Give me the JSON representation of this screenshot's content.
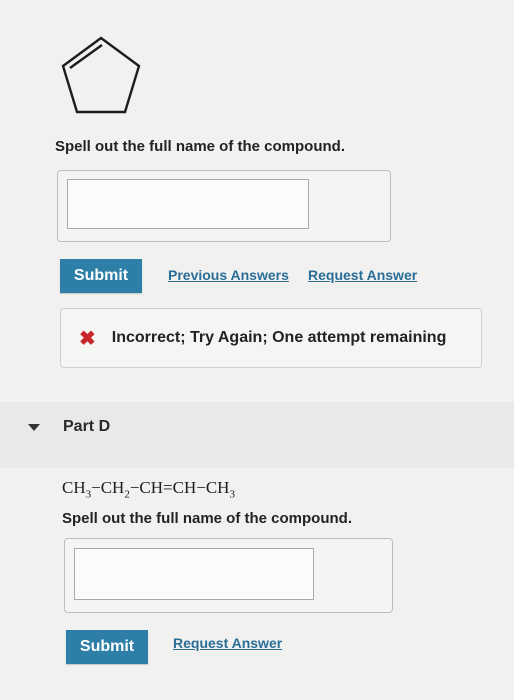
{
  "part_c": {
    "prompt": "Spell out the full name of the compound.",
    "answer_value": "",
    "submit_label": "Submit",
    "previous_answers_label": "Previous Answers",
    "request_answer_label": "Request Answer",
    "feedback_text": "Incorrect; Try Again; One attempt remaining",
    "feedback_icon": "x-mark-icon"
  },
  "part_d": {
    "label": "Part D",
    "formula": [
      "CH",
      "3",
      "−CH",
      "2",
      "−CH=CH−CH",
      "3"
    ],
    "prompt": "Spell out the full name of the compound.",
    "answer_value": "",
    "submit_label": "Submit",
    "request_answer_label": "Request Answer"
  },
  "colors": {
    "accent": "#2e7fa8",
    "link": "#2a6e98",
    "error": "#c8262b"
  }
}
